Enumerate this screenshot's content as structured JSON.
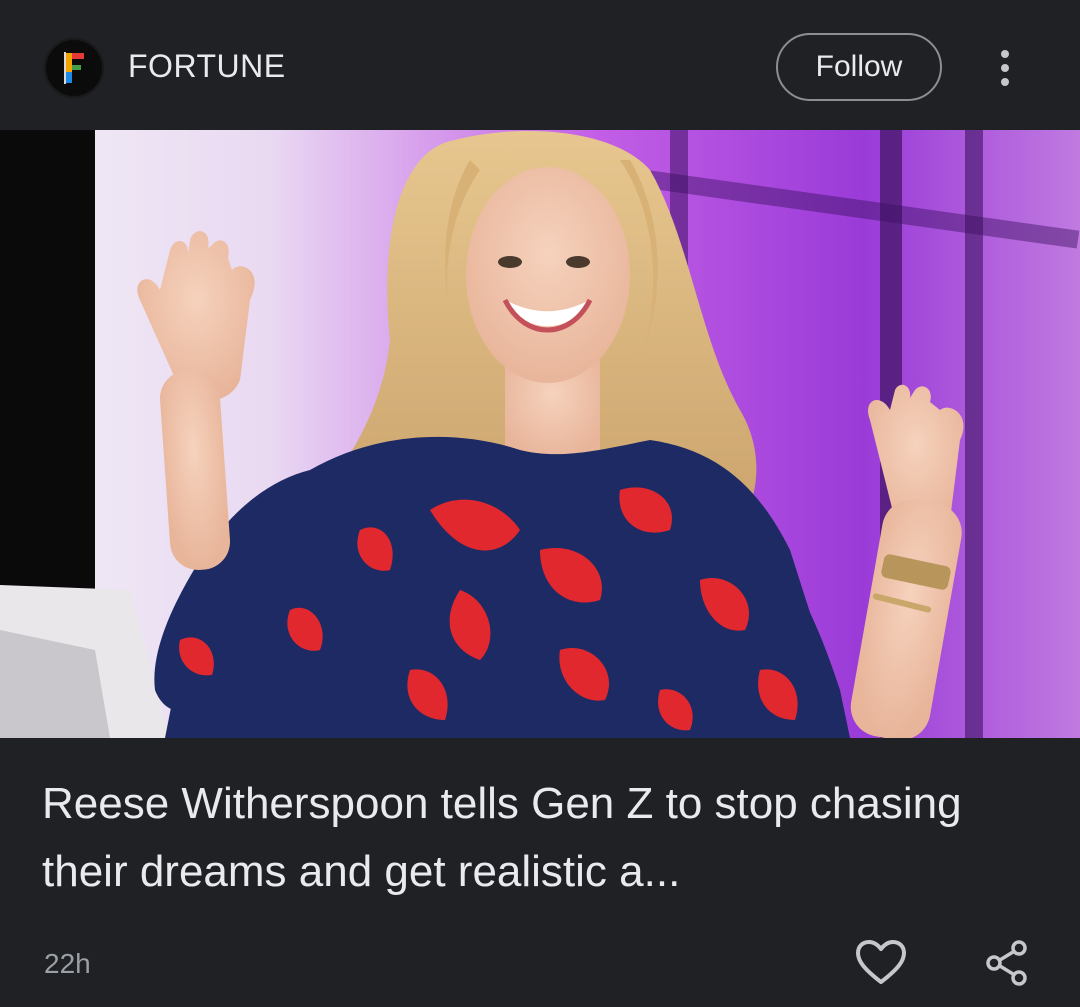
{
  "header": {
    "publisher": "FORTUNE",
    "logo_letter": "F",
    "follow_label": "Follow",
    "more_icon": "more-vertical-icon"
  },
  "hero": {
    "image_subject": "woman in floral dress waving on stage"
  },
  "article": {
    "title": "Reese Witherspoon tells Gen Z to stop chasing their dreams and get realistic a..."
  },
  "footer": {
    "time_ago": "22h",
    "like_icon": "heart-icon",
    "share_icon": "share-icon"
  },
  "colors": {
    "background": "#202124",
    "text": "#e8eaed",
    "muted": "#9aa0a6",
    "button_border": "#8b8f94"
  }
}
